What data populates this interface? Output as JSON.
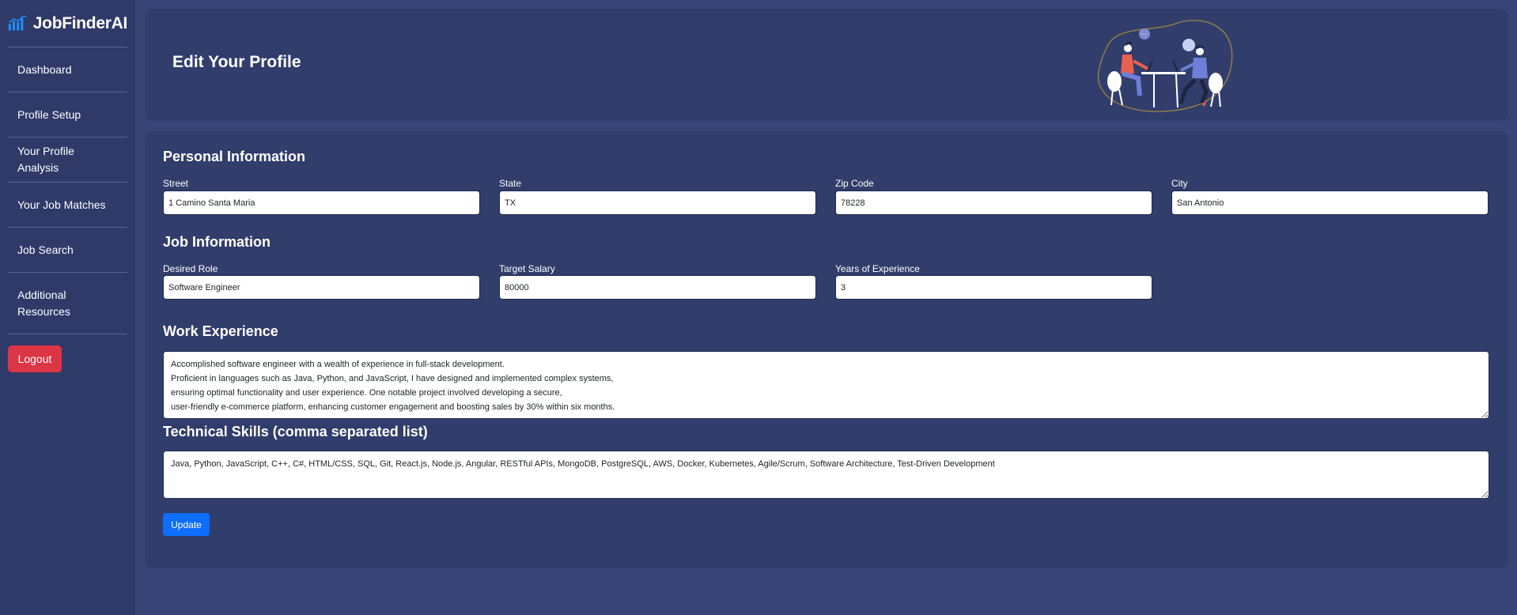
{
  "app": {
    "brand": "JobFinderAI",
    "colors": {
      "sidebar_bg": "#2f3a69",
      "card_bg": "#313d6b",
      "page_bg": "#384476",
      "logout": "#dc3545",
      "primary": "#0d6efd"
    }
  },
  "sidebar": {
    "items": [
      {
        "label": "Dashboard"
      },
      {
        "label": "Profile Setup"
      },
      {
        "label": "Your Profile Analysis"
      },
      {
        "label": "Your Job Matches"
      },
      {
        "label": "Job Search"
      },
      {
        "label": "Additional Resources"
      }
    ],
    "logout_label": "Logout"
  },
  "header": {
    "title": "Edit Your Profile",
    "illustration_icon": "meeting-illustration"
  },
  "personal": {
    "title": "Personal Information",
    "street": {
      "label": "Street",
      "value": "1 Camino Santa Maria"
    },
    "state": {
      "label": "State",
      "value": "TX"
    },
    "zip": {
      "label": "Zip Code",
      "value": "78228"
    },
    "city": {
      "label": "City",
      "value": "San Antonio"
    }
  },
  "job": {
    "title": "Job Information",
    "role": {
      "label": "Desired Role",
      "value": "Software Engineer"
    },
    "salary": {
      "label": "Target Salary",
      "value": "80000"
    },
    "years": {
      "label": "Years of Experience",
      "value": "3"
    }
  },
  "work": {
    "title": "Work Experience",
    "value": "Accomplished software engineer with a wealth of experience in full-stack development.\nProficient in languages such as Java, Python, and JavaScript, I have designed and implemented complex systems,\nensuring optimal functionality and user experience. One notable project involved developing a secure,\nuser-friendly e-commerce platform, enhancing customer engagement and boosting sales by 30% within six months."
  },
  "skills": {
    "title": "Technical Skills (comma separated list)",
    "value": "Java, Python, JavaScript, C++, C#, HTML/CSS, SQL, Git, React.js, Node.js, Angular, RESTful APIs, MongoDB, PostgreSQL, AWS, Docker, Kubernetes, Agile/Scrum, Software Architecture, Test-Driven Development"
  },
  "form": {
    "update_label": "Update"
  }
}
